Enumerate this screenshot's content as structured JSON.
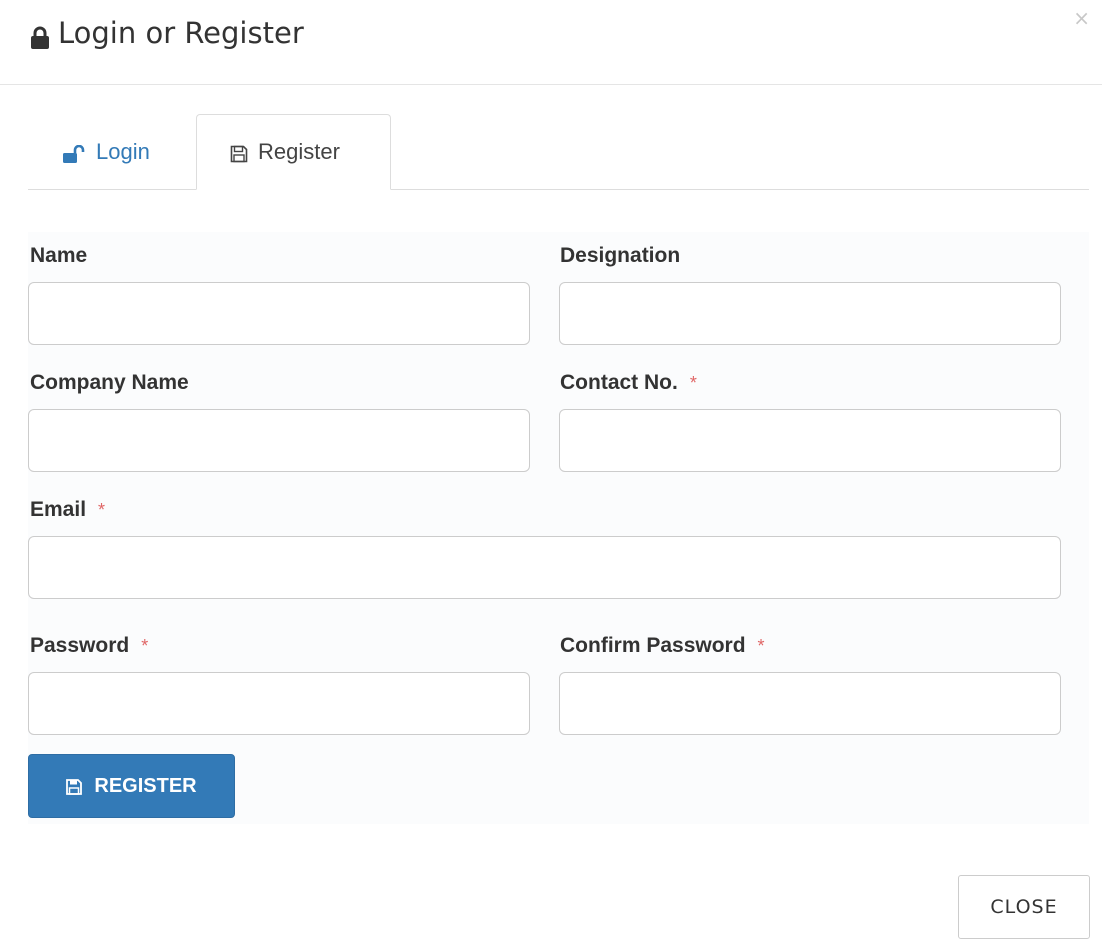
{
  "modal": {
    "title": "Login or Register",
    "title_icon": "lock-icon",
    "close_glyph": "×"
  },
  "tabs": [
    {
      "label": "Login",
      "icon": "unlock-icon",
      "active": false
    },
    {
      "label": "Register",
      "icon": "floppy-disk-icon",
      "active": true
    }
  ],
  "form": {
    "name": {
      "label": "Name",
      "value": "",
      "required": false
    },
    "designation": {
      "label": "Designation",
      "value": "",
      "required": false
    },
    "company": {
      "label": "Company Name",
      "value": "",
      "required": false
    },
    "contact": {
      "label": "Contact No.",
      "value": "",
      "required": true
    },
    "email": {
      "label": "Email",
      "value": "",
      "required": true
    },
    "password": {
      "label": "Password",
      "value": "",
      "required": true
    },
    "confirm_password": {
      "label": "Confirm Password",
      "value": "",
      "required": true
    },
    "required_marker": "*"
  },
  "buttons": {
    "register_label": "REGISTER",
    "register_icon": "floppy-disk-icon",
    "close_label": "CLOSE"
  },
  "colors": {
    "primary": "#337ab7",
    "required": "#e06666",
    "border": "#cccccc"
  }
}
